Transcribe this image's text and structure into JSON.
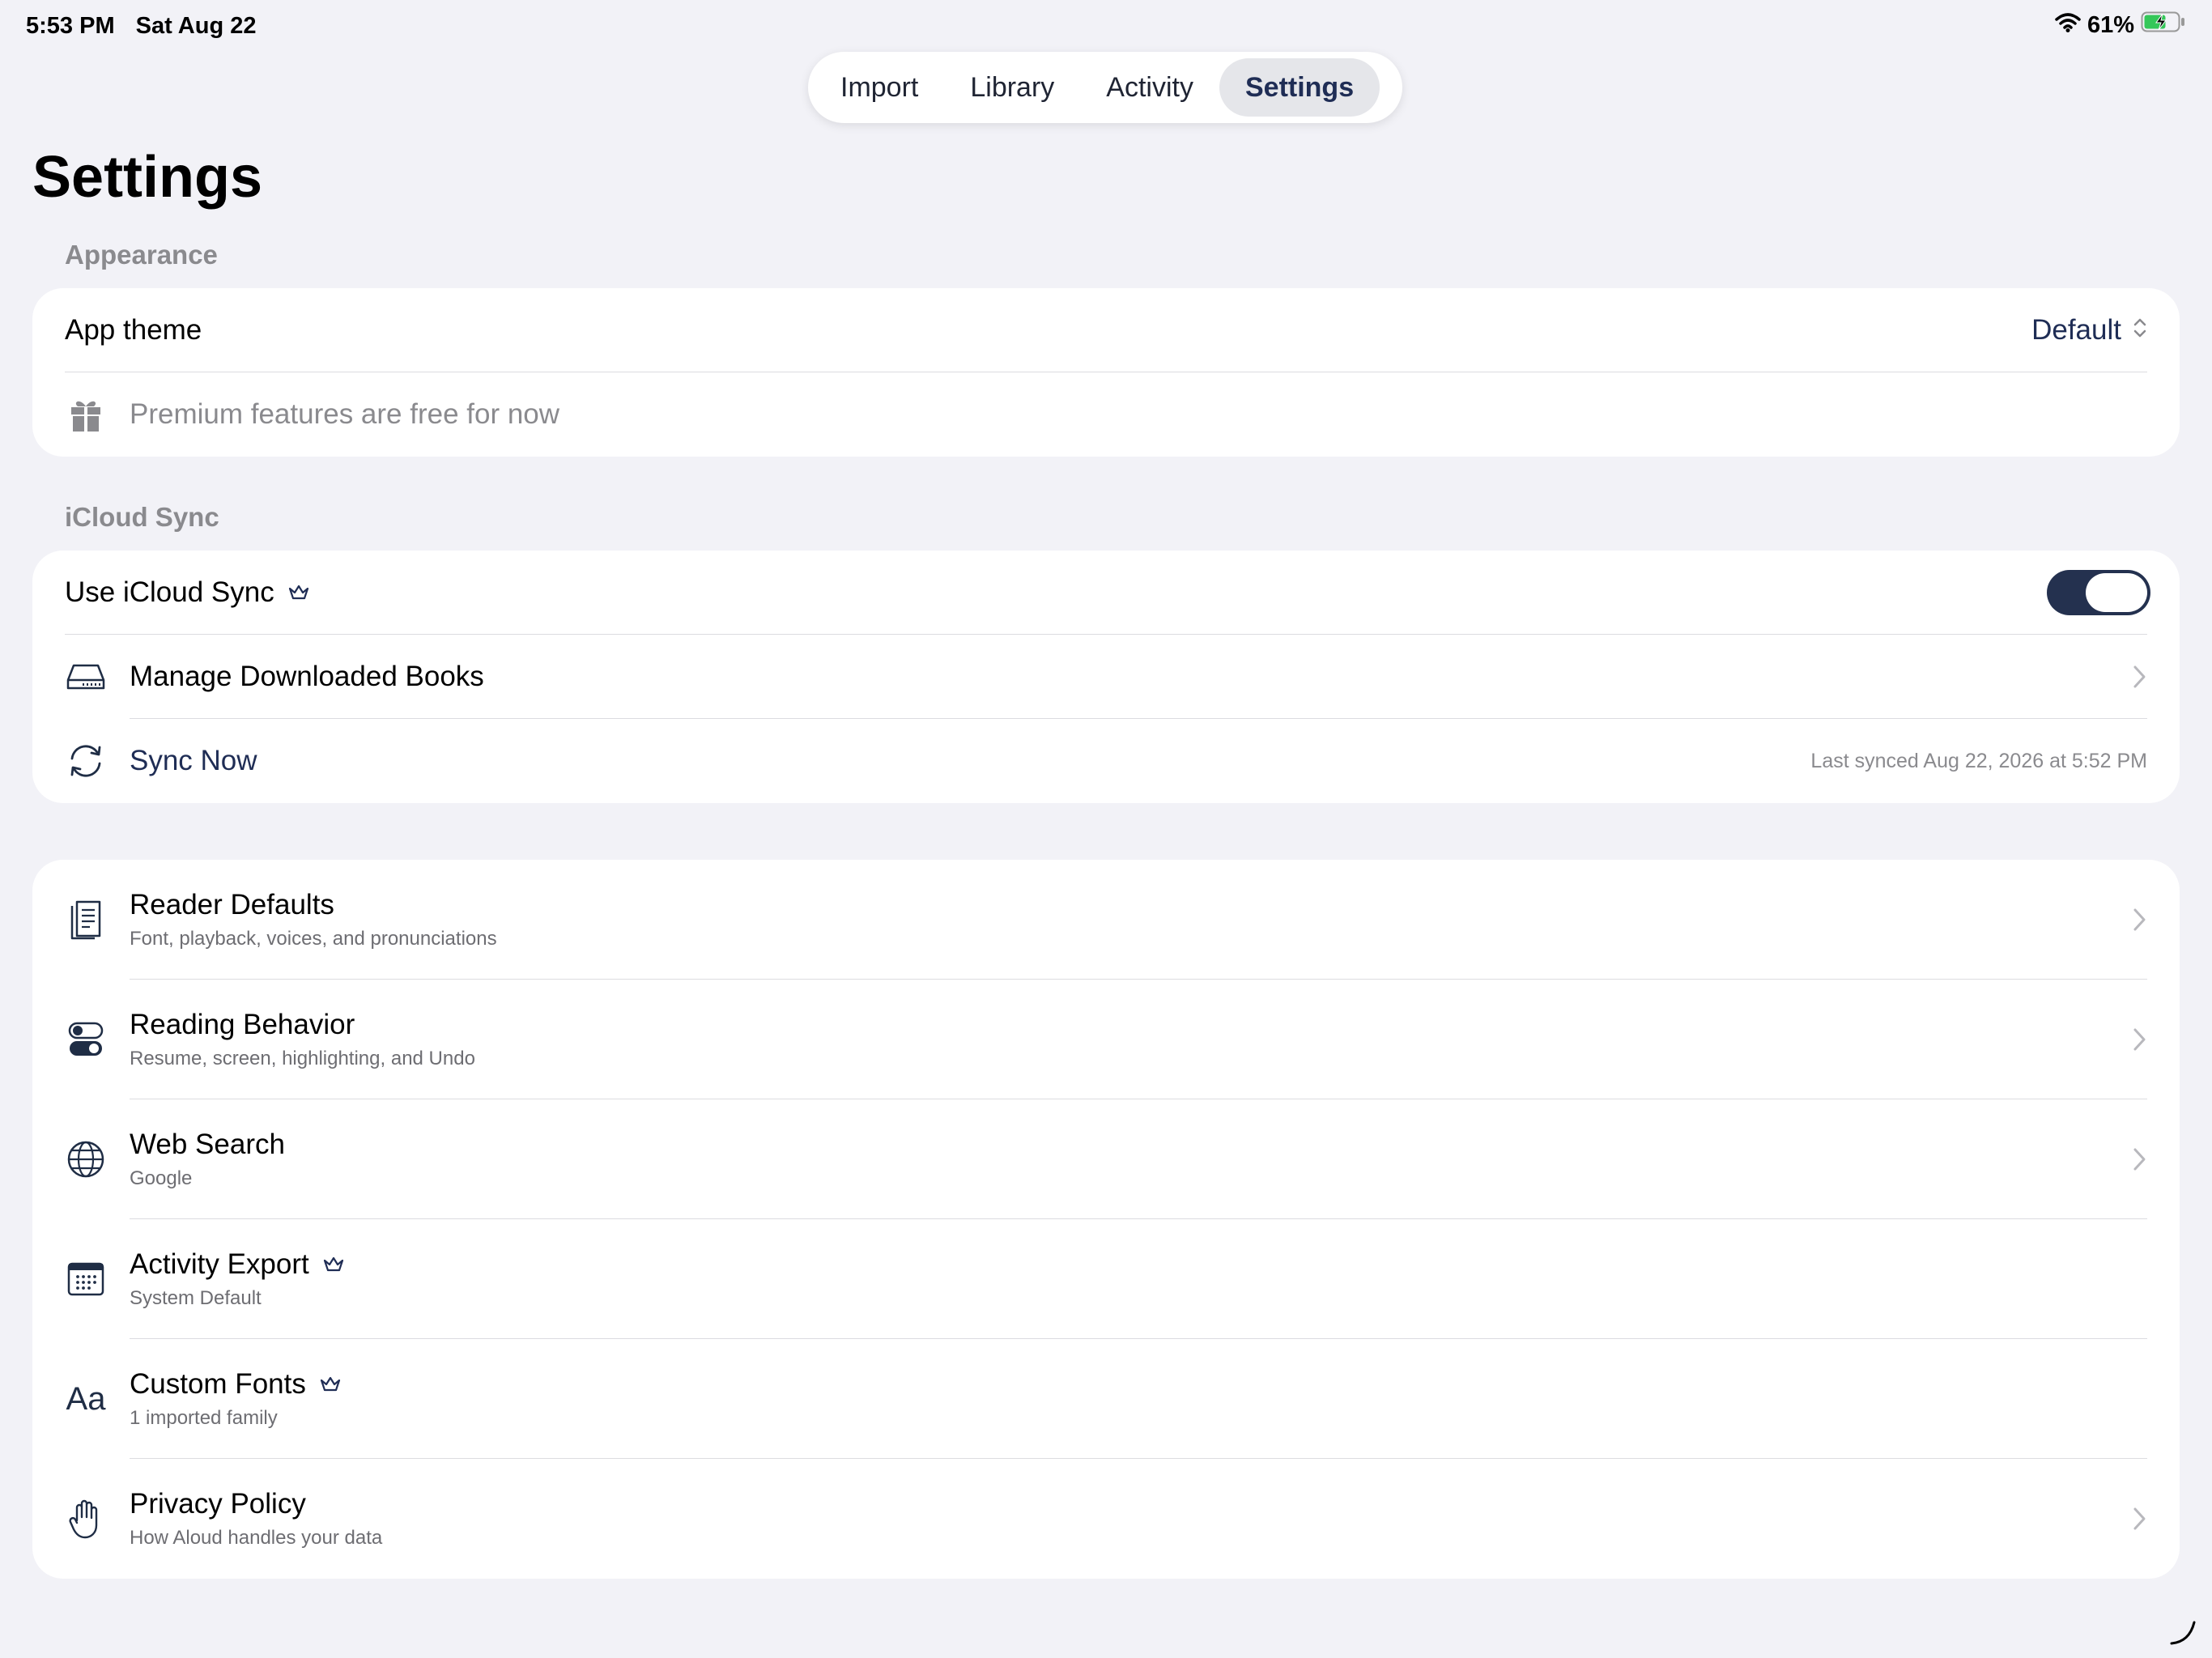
{
  "status": {
    "time": "5:53 PM",
    "date": "Sat Aug 22",
    "battery": "61%"
  },
  "tabs": [
    {
      "label": "Import"
    },
    {
      "label": "Library"
    },
    {
      "label": "Activity"
    },
    {
      "label": "Settings"
    }
  ],
  "page": {
    "title": "Settings"
  },
  "appearance": {
    "header": "Appearance",
    "theme_label": "App theme",
    "theme_value": "Default",
    "promo": "Premium features are free for now"
  },
  "icloud": {
    "header": "iCloud Sync",
    "use_sync_label": "Use iCloud Sync",
    "use_sync_on": true,
    "manage_label": "Manage Downloaded Books",
    "sync_now_label": "Sync Now",
    "last_synced": "Last synced Aug 22, 2026 at 5:52 PM"
  },
  "menu": [
    {
      "title": "Reader Defaults",
      "subtitle": "Font, playback, voices, and pronunciations",
      "icon": "document-icon"
    },
    {
      "title": "Reading Behavior",
      "subtitle": "Resume, screen, highlighting, and Undo",
      "icon": "switches-icon"
    },
    {
      "title": "Web Search",
      "subtitle": "Google",
      "icon": "globe-icon"
    },
    {
      "title": "Activity Export",
      "subtitle": "System Default",
      "icon": "calendar-icon"
    },
    {
      "title": "Custom Fonts",
      "subtitle": "1 imported family",
      "icon": "font-icon",
      "icon_text": "Aa"
    },
    {
      "title": "Privacy Policy",
      "subtitle": "How Aloud handles your data",
      "icon": "hand-icon"
    }
  ],
  "colors": {
    "background": "#f2f2f7",
    "accent": "#1f2d55",
    "toggle_on": "#24314f",
    "secondary_text": "#8a8a8e"
  }
}
